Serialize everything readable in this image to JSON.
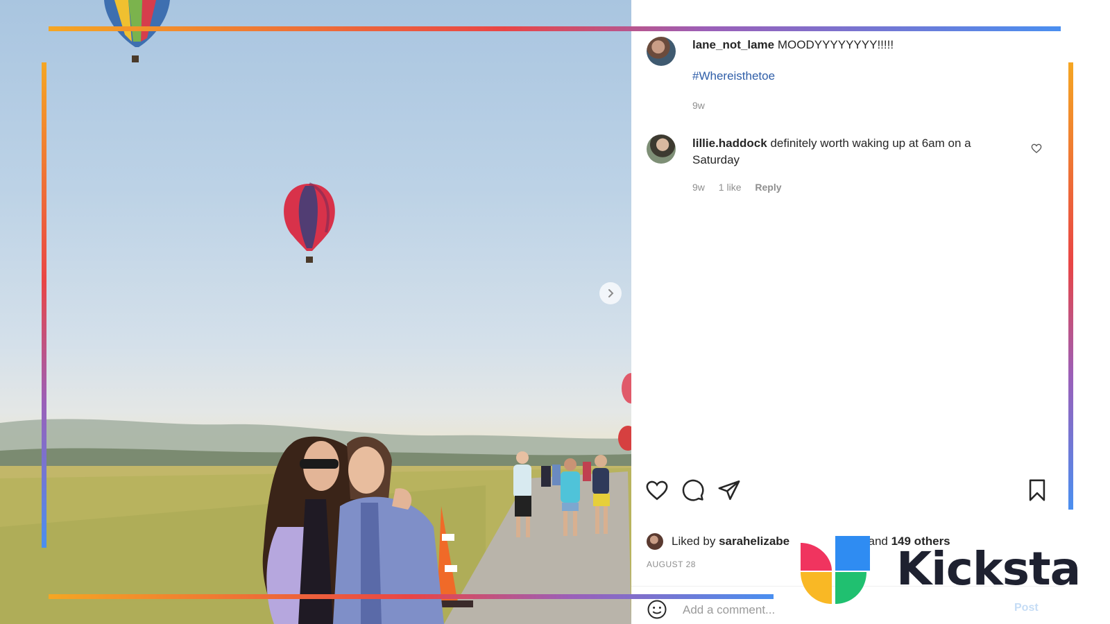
{
  "post": {
    "next_icon": "chevron-right-icon"
  },
  "comments": [
    {
      "username": "lane_not_lame",
      "text": "MOODYYYYYYYY!!!!!",
      "hashtag": "#Whereisthetoe",
      "time": "9w"
    },
    {
      "username": "lillie.haddock",
      "text": "definitely worth waking up at 6am on a Saturday",
      "time": "9w",
      "likes": "1 like",
      "reply_label": "Reply"
    }
  ],
  "actions": {
    "like_icon": "heart-icon",
    "comment_icon": "comment-bubble-icon",
    "share_icon": "paper-plane-icon",
    "save_icon": "bookmark-icon"
  },
  "likes": {
    "prefix": "Liked by",
    "user": "sarahelizabe",
    "middle": "and",
    "others": "149 others"
  },
  "date": "AUGUST 28",
  "add_comment": {
    "placeholder": "Add a comment...",
    "post_label": "Post",
    "emoji_icon": "smiley-icon"
  },
  "branding": {
    "name": "Kicksta",
    "colors": {
      "pink": "#f0345f",
      "blue": "#2f8cf2",
      "yellow": "#f9b825",
      "green": "#20c070",
      "text": "#1e2130"
    }
  },
  "frame_colors": [
    "#f5a623",
    "#e94545",
    "#9b5fb8",
    "#4a8ff0"
  ]
}
